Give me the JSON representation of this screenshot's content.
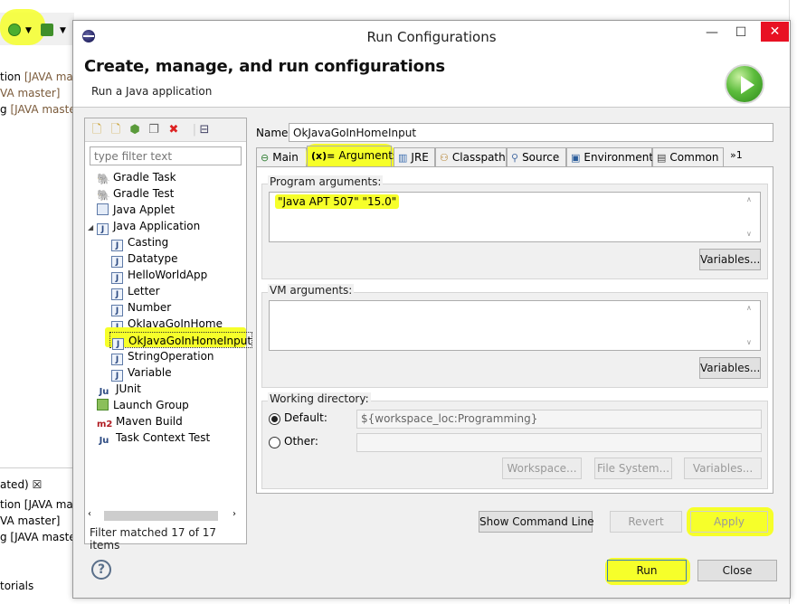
{
  "background": {
    "left_lines_top": [
      {
        "pre": "tion ",
        "brown": "[JAVA mas"
      },
      {
        "pre": "",
        "brown": "VA master]"
      },
      {
        "pre": "g ",
        "brown": "[JAVA master"
      }
    ],
    "view_tab_label": "ated)",
    "view_tab_close": "☒",
    "left_lines_bottom": [
      "tion [JAVA ma",
      "VA master]",
      "g [JAVA master",
      "torials"
    ]
  },
  "dialog": {
    "title": "Run Configurations",
    "window_buttons": {
      "minimize": "—",
      "maximize": "☐",
      "close": "✕"
    },
    "header": {
      "title": "Create, manage, and run configurations",
      "subtitle": "Run a Java application"
    }
  },
  "left_panel": {
    "filter_placeholder": "type filter text",
    "tree": [
      {
        "label": "Gradle Task",
        "icon": "gradle-icon",
        "level": 0
      },
      {
        "label": "Gradle Test",
        "icon": "gradle-icon",
        "level": 0
      },
      {
        "label": "Java Applet",
        "icon": "java-applet-icon",
        "level": 0
      },
      {
        "label": "Java Application",
        "icon": "java-app-icon",
        "level": 0,
        "expanded": true
      },
      {
        "label": "Casting",
        "icon": "java-app-icon",
        "level": 1
      },
      {
        "label": "Datatype",
        "icon": "java-app-icon",
        "level": 1
      },
      {
        "label": "HelloWorldApp",
        "icon": "java-app-icon",
        "level": 1
      },
      {
        "label": "Letter",
        "icon": "java-app-icon",
        "level": 1
      },
      {
        "label": "Number",
        "icon": "java-app-icon",
        "level": 1
      },
      {
        "label": "OkJavaGoInHome",
        "icon": "java-app-icon",
        "level": 1
      },
      {
        "label": "OkJavaGoInHomeInput",
        "icon": "java-app-icon",
        "level": 1,
        "selected": true
      },
      {
        "label": "StringOperation",
        "icon": "java-app-icon",
        "level": 1
      },
      {
        "label": "Variable",
        "icon": "java-app-icon",
        "level": 1
      },
      {
        "label": "JUnit",
        "icon": "junit-icon",
        "level": 0
      },
      {
        "label": "Launch Group",
        "icon": "launch-group-icon",
        "level": 0
      },
      {
        "label": "Maven Build",
        "icon": "maven-icon",
        "level": 0
      },
      {
        "label": "Task Context Test",
        "icon": "junit-icon",
        "level": 0
      }
    ],
    "filter_status": "Filter matched 17 of 17 items"
  },
  "config": {
    "name_label": "Name:",
    "name_value": "OkJavaGoInHomeInput",
    "tabs": [
      {
        "label": "Main",
        "icon": "main-tab-icon"
      },
      {
        "label": "Arguments",
        "icon": "arguments-tab-icon",
        "active": true
      },
      {
        "label": "JRE",
        "icon": "jre-tab-icon"
      },
      {
        "label": "Classpath",
        "icon": "classpath-tab-icon"
      },
      {
        "label": "Source",
        "icon": "source-tab-icon"
      },
      {
        "label": "Environment",
        "icon": "environment-tab-icon"
      },
      {
        "label": "Common",
        "icon": "common-tab-icon"
      }
    ],
    "tabs_overflow": "»1",
    "program_arguments_label": "Program arguments:",
    "program_arguments_value": "\"Java APT 507\" \"15.0\"",
    "vm_arguments_label": "VM arguments:",
    "vm_arguments_value": "",
    "variables_label": "Variables...",
    "working_directory_label": "Working directory:",
    "default_label": "Default:",
    "default_value": "${workspace_loc:Programming}",
    "other_label": "Other:",
    "workspace_button": "Workspace...",
    "file_system_button": "File System...",
    "wd_variables_button": "Variables...",
    "show_command_line": "Show Command Line",
    "revert": "Revert",
    "apply": "Apply"
  },
  "footer": {
    "run": "Run",
    "close": "Close"
  },
  "colors": {
    "highlight": "#f6ff2a",
    "close_red": "#e81123",
    "dialog_bg": "#f0f0f0"
  }
}
